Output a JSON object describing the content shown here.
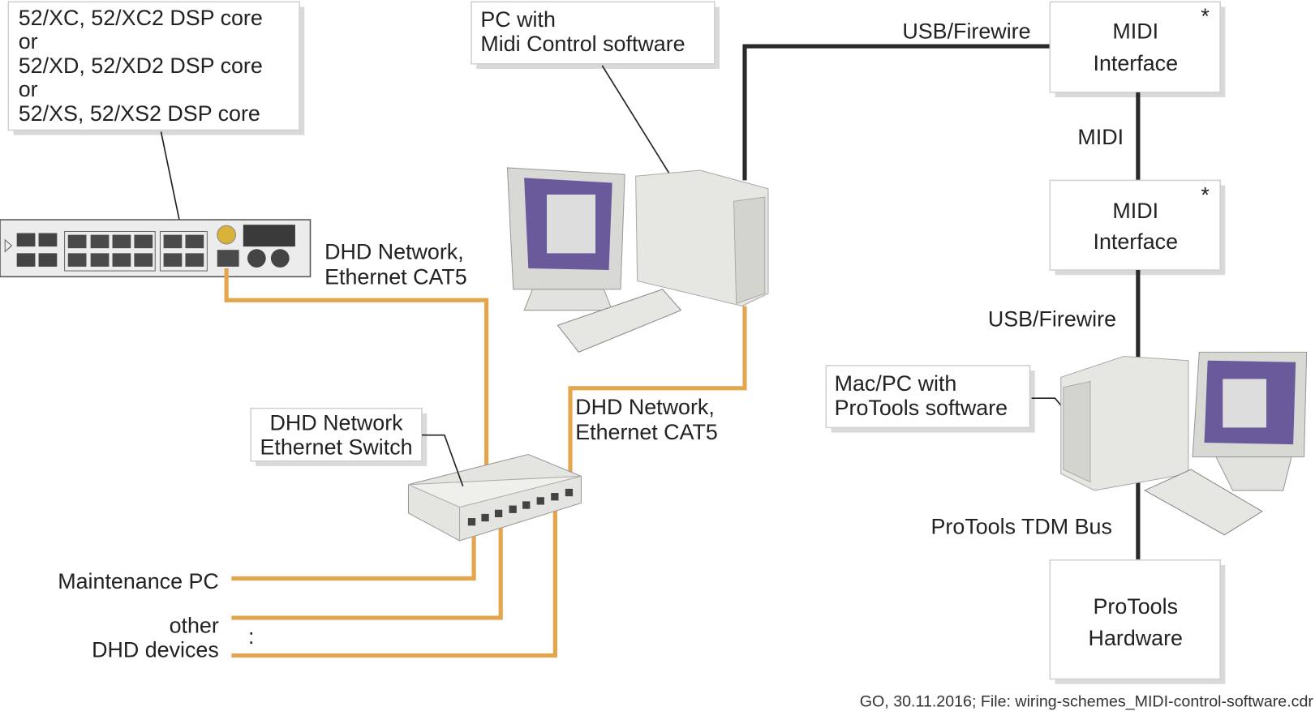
{
  "dsp_core_label": [
    "52/XC, 52/XC2 DSP core",
    "or",
    "52/XD, 52/XD2 DSP core",
    "or",
    "52/XS, 52/XS2 DSP core"
  ],
  "pc_midi_label": [
    "PC with",
    "Midi Control software"
  ],
  "dhd_network_left": [
    "DHD Network,",
    "Ethernet CAT5"
  ],
  "dhd_network_right": [
    "DHD Network,",
    "Ethernet CAT5"
  ],
  "switch_label": [
    "DHD Network",
    "Ethernet Switch"
  ],
  "maintenance_pc": "Maintenance PC",
  "other_devices": [
    "other",
    "DHD devices"
  ],
  "ellipsis": ":",
  "usb_firewire_top": "USB/Firewire",
  "midi_interface_1": [
    "MIDI",
    "Interface"
  ],
  "midi_interface_2": [
    "MIDI",
    "Interface"
  ],
  "asterisk": "*",
  "midi_link": "MIDI",
  "usb_firewire_mid": "USB/Firewire",
  "macpc_label": [
    "Mac/PC with",
    "ProTools software"
  ],
  "tdm_bus": "ProTools TDM Bus",
  "protools_hw": [
    "ProTools",
    "Hardware"
  ],
  "footer": "GO, 30.11.2016; File: wiring-schemes_MIDI-control-software.cdr",
  "colors": {
    "ethernet": "#e3a64d",
    "usb_midi": "#2a2a2a",
    "screen": "#6a5a9c"
  }
}
